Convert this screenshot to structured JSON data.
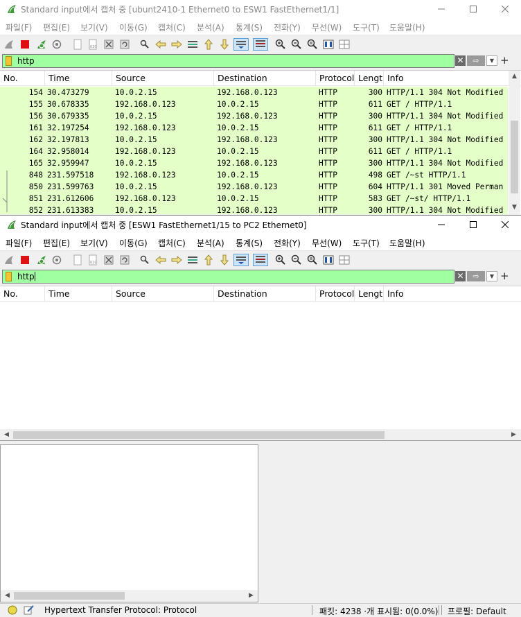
{
  "window1": {
    "title": "Standard input에서 캡처 중 [ubunt2410-1 Ethernet0 to ESW1 FastEthernet1/1]",
    "menu": [
      "파일(F)",
      "편집(E)",
      "보기(V)",
      "이동(G)",
      "캡처(C)",
      "분석(A)",
      "통계(S)",
      "전화(Y)",
      "무선(W)",
      "도구(T)",
      "도움말(H)"
    ],
    "filter": {
      "value": "http"
    },
    "columns": [
      "No.",
      "Time",
      "Source",
      "Destination",
      "Protocol",
      "Lengt",
      "Info"
    ],
    "rows": [
      {
        "no": "154",
        "time": "30.473279",
        "src": "10.0.2.15",
        "dst": "192.168.0.123",
        "proto": "HTTP",
        "len": "300",
        "info": "HTTP/1.1 304 Not Modified"
      },
      {
        "no": "155",
        "time": "30.678335",
        "src": "192.168.0.123",
        "dst": "10.0.2.15",
        "proto": "HTTP",
        "len": "611",
        "info": "GET / HTTP/1.1"
      },
      {
        "no": "156",
        "time": "30.679335",
        "src": "10.0.2.15",
        "dst": "192.168.0.123",
        "proto": "HTTP",
        "len": "300",
        "info": "HTTP/1.1 304 Not Modified"
      },
      {
        "no": "161",
        "time": "32.197254",
        "src": "192.168.0.123",
        "dst": "10.0.2.15",
        "proto": "HTTP",
        "len": "611",
        "info": "GET / HTTP/1.1"
      },
      {
        "no": "162",
        "time": "32.197813",
        "src": "10.0.2.15",
        "dst": "192.168.0.123",
        "proto": "HTTP",
        "len": "300",
        "info": "HTTP/1.1 304 Not Modified"
      },
      {
        "no": "164",
        "time": "32.958014",
        "src": "192.168.0.123",
        "dst": "10.0.2.15",
        "proto": "HTTP",
        "len": "611",
        "info": "GET / HTTP/1.1"
      },
      {
        "no": "165",
        "time": "32.959947",
        "src": "10.0.2.15",
        "dst": "192.168.0.123",
        "proto": "HTTP",
        "len": "300",
        "info": "HTTP/1.1 304 Not Modified"
      },
      {
        "no": "848",
        "time": "231.597518",
        "src": "192.168.0.123",
        "dst": "10.0.2.15",
        "proto": "HTTP",
        "len": "498",
        "info": "GET /~st HTTP/1.1"
      },
      {
        "no": "850",
        "time": "231.599763",
        "src": "10.0.2.15",
        "dst": "192.168.0.123",
        "proto": "HTTP",
        "len": "604",
        "info": "HTTP/1.1 301 Moved Perman"
      },
      {
        "no": "851",
        "time": "231.612606",
        "src": "192.168.0.123",
        "dst": "10.0.2.15",
        "proto": "HTTP",
        "len": "583",
        "info": "GET /~st/ HTTP/1.1"
      },
      {
        "no": "852",
        "time": "231.613383",
        "src": "10.0.2.15",
        "dst": "192.168.0.123",
        "proto": "HTTP",
        "len": "300",
        "info": "HTTP/1.1 304 Not Modified"
      }
    ]
  },
  "window2": {
    "title": "Standard input에서 캡처 중 [ESW1 FastEthernet1/15 to PC2 Ethernet0]",
    "menu": [
      "파일(F)",
      "편집(E)",
      "보기(V)",
      "이동(G)",
      "캡처(C)",
      "분석(A)",
      "통계(S)",
      "전화(Y)",
      "무선(W)",
      "도구(T)",
      "도움말(H)"
    ],
    "filter": {
      "value": "http"
    },
    "columns": [
      "No.",
      "Time",
      "Source",
      "Destination",
      "Protocol",
      "Lengt",
      "Info"
    ],
    "status": {
      "field": "Hypertext Transfer Protocol: Protocol",
      "packets": "패킷: 4238 ·개 표시됨: 0(0.0%)",
      "profile": "프로필: Default"
    }
  },
  "colors": {
    "filter_ok": "#a0ffa0",
    "http_row": "#e4ffc7",
    "accent": "#5e9ed6"
  },
  "icons": [
    "shark-fin-icon",
    "stop-icon",
    "restart-icon",
    "options-icon",
    "open-icon",
    "save-icon",
    "close-file-icon",
    "reload-icon",
    "find-icon",
    "back-icon",
    "forward-icon",
    "goto-icon",
    "first-icon",
    "last-icon",
    "autoscroll-icon",
    "colorize-icon",
    "zoom-in-icon",
    "zoom-out-icon",
    "normal-size-icon",
    "resize-columns-icon",
    "layout-icon"
  ]
}
